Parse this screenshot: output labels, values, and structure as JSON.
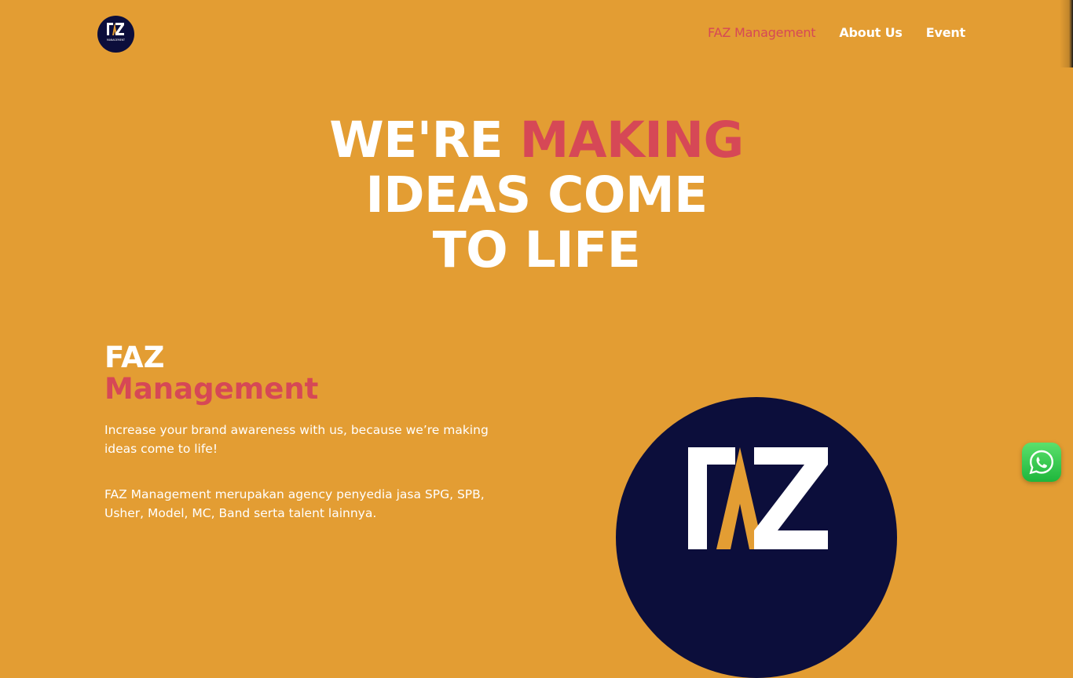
{
  "header": {
    "logo_icon": "faz-management-logo",
    "logo_text": "FAZ",
    "logo_subtext": "MANAGEMENT",
    "nav": [
      {
        "label": "FAZ Management",
        "active": true
      },
      {
        "label": "About Us",
        "active": false
      },
      {
        "label": "Event",
        "active": false
      }
    ]
  },
  "hero": {
    "line1_white": "WE'RE ",
    "line1_accent": "MAKING",
    "line2": "IDEAS COME",
    "line3": "TO LIFE"
  },
  "about": {
    "title_white": "FAZ",
    "title_accent": "Management",
    "tagline": "Increase your brand awareness with us, because we’re making ideas come to life!",
    "body": "FAZ Management merupakan agency penyedia jasa SPG, SPB, Usher, Model, MC, Band serta talent lainnya."
  },
  "whatsapp": {
    "icon": "whatsapp-icon"
  },
  "colors": {
    "background": "#E39D33",
    "accent": "#D64856",
    "navy": "#0C0E3B",
    "whatsapp": "#25D366"
  }
}
